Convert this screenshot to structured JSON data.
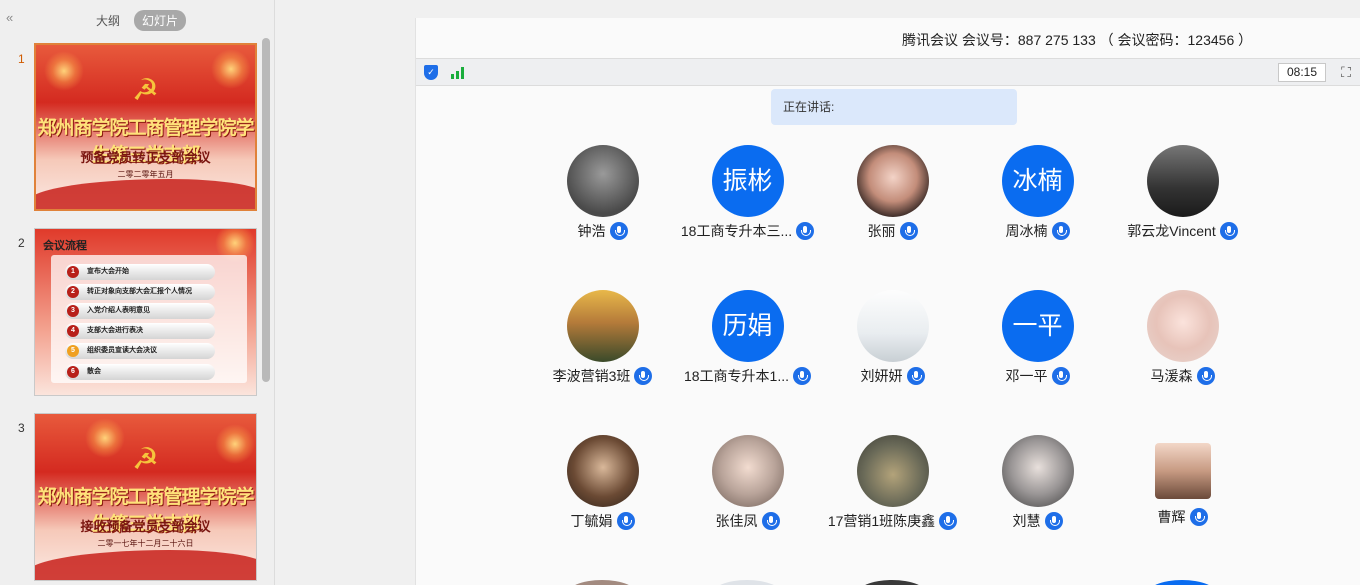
{
  "left_panel": {
    "collapse_icon": "«",
    "tabs": [
      {
        "label": "大纲",
        "active": false
      },
      {
        "label": "幻灯片",
        "active": true
      }
    ],
    "slides": [
      {
        "number": "1",
        "title": "郑州商学院工商管理学院学生第三党支部",
        "subtitle": "预备党员转正支部会议",
        "date": "二零二零年五月"
      },
      {
        "number": "2",
        "title": "会议流程",
        "items": [
          {
            "num": "1",
            "text": "宣布大会开始"
          },
          {
            "num": "2",
            "text": "转正对象向支部大会汇报个人情况"
          },
          {
            "num": "3",
            "text": "入党介绍人表明意见"
          },
          {
            "num": "4",
            "text": "支部大会进行表决"
          },
          {
            "num": "5",
            "text": "组织委员宣读大会决议"
          },
          {
            "num": "6",
            "text": "散会"
          }
        ]
      },
      {
        "number": "3",
        "title": "郑州商学院工商管理学院学生第三党支部",
        "subtitle": "接收预备党员支部会议",
        "date": "二零一七年十二月二十六日"
      }
    ]
  },
  "meeting": {
    "title": "腾讯会议 会议号：887 275 133 （ 会议密码：123456 ）",
    "timer": "08:15",
    "speaking_label": "正在讲话:",
    "participants": [
      {
        "name": "钟浩",
        "avatar_text": "",
        "avatar_style": "photo1"
      },
      {
        "name": "18工商专升本三...",
        "avatar_text": "振彬",
        "avatar_style": "text"
      },
      {
        "name": "张丽",
        "avatar_text": "",
        "avatar_style": "photo2"
      },
      {
        "name": "周冰楠",
        "avatar_text": "冰楠",
        "avatar_style": "text"
      },
      {
        "name": "郭云龙Vincent",
        "avatar_text": "",
        "avatar_style": "photo3"
      },
      {
        "name": "李波营销3班",
        "avatar_text": "",
        "avatar_style": "photo4"
      },
      {
        "name": "18工商专升本1...",
        "avatar_text": "历娟",
        "avatar_style": "text"
      },
      {
        "name": "刘妍妍",
        "avatar_text": "",
        "avatar_style": "photo5"
      },
      {
        "name": "邓一平",
        "avatar_text": "一平",
        "avatar_style": "text"
      },
      {
        "name": "马湲森",
        "avatar_text": "",
        "avatar_style": "photo6"
      },
      {
        "name": "丁毓娟",
        "avatar_text": "",
        "avatar_style": "photo7"
      },
      {
        "name": "张佳凤",
        "avatar_text": "",
        "avatar_style": "photo8"
      },
      {
        "name": "17营销1班陈庚鑫",
        "avatar_text": "",
        "avatar_style": "photo9"
      },
      {
        "name": "刘慧",
        "avatar_text": "",
        "avatar_style": "photo10"
      },
      {
        "name": "曹辉",
        "avatar_text": "",
        "avatar_style": "photo11"
      }
    ]
  }
}
